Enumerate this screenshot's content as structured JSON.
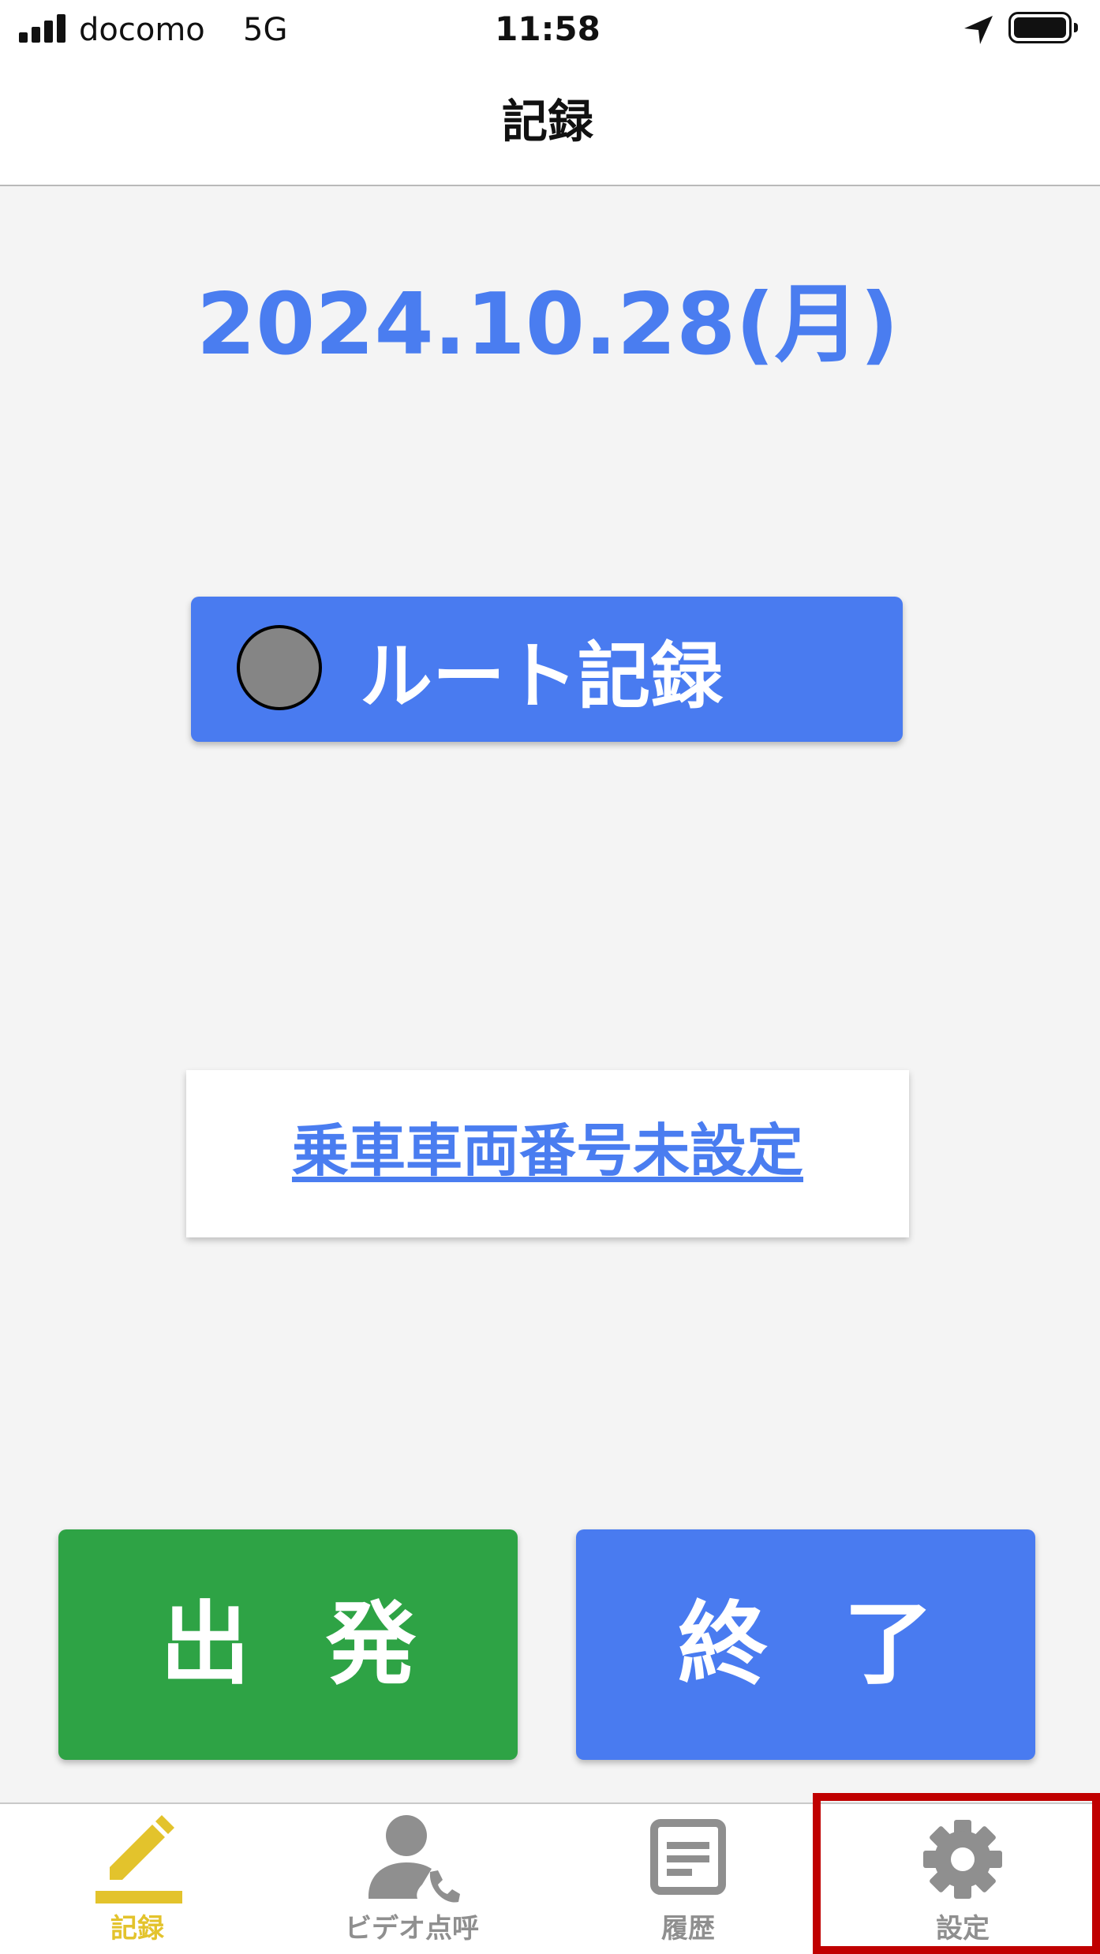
{
  "status_bar": {
    "carrier": "docomo",
    "network": "5G",
    "time": "11:58",
    "icons": [
      "signal-icon",
      "location-arrow-icon",
      "battery-icon"
    ]
  },
  "header": {
    "title": "記録"
  },
  "main": {
    "date": "2024.10.28(月)",
    "route_record_label": "ルート記録",
    "vehicle_link_label": "乗車車両番号未設定",
    "depart_label": "出発",
    "finish_label": "終了"
  },
  "tab_bar": {
    "active_index": 0,
    "items": [
      {
        "label": "記録",
        "icon": "pencil-icon"
      },
      {
        "label": "ビデオ点呼",
        "icon": "person-phone-icon"
      },
      {
        "label": "履歴",
        "icon": "document-icon"
      },
      {
        "label": "設定",
        "icon": "gear-icon"
      }
    ]
  },
  "colors": {
    "accent_blue": "#497bf0",
    "depart_green": "#2ea345",
    "active_tab_yellow": "#e3c32c",
    "inactive_tab_gray": "#8f8f8f",
    "highlight_red": "#c00000",
    "background": "#f4f4f4"
  }
}
